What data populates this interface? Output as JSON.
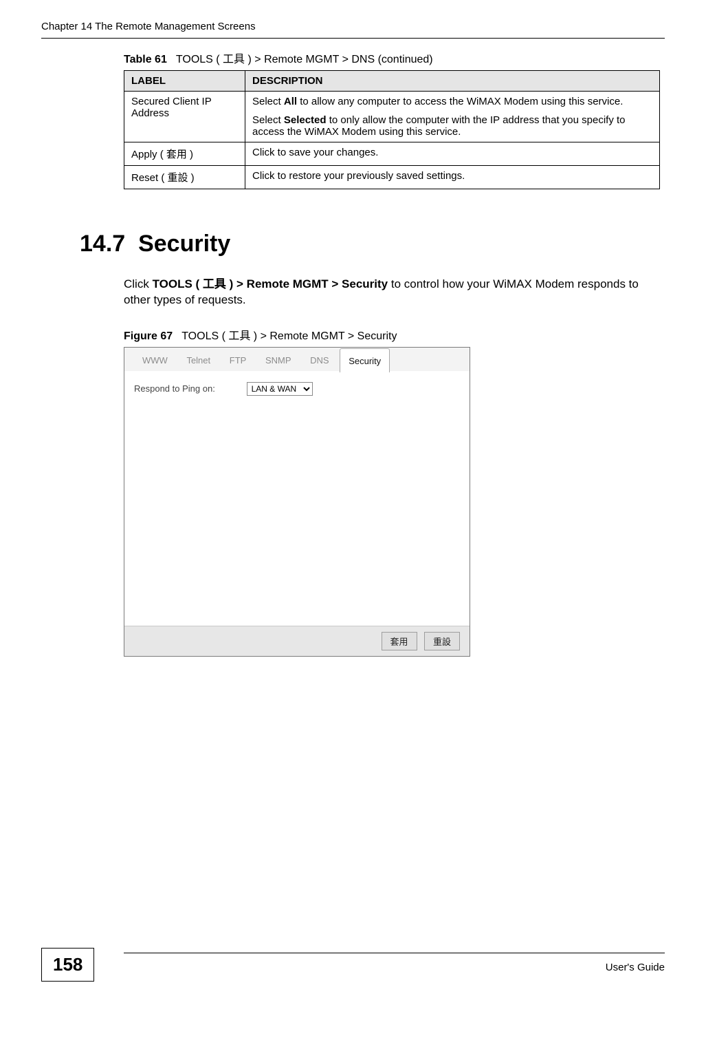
{
  "running_header": "Chapter 14 The Remote Management Screens",
  "table61": {
    "caption_prefix": "Table 61",
    "caption_text": "TOOLS ( 工具 ) > Remote MGMT > DNS (continued)",
    "headers": {
      "label": "LABEL",
      "description": "DESCRIPTION"
    },
    "rows": [
      {
        "label": "Secured Client IP Address",
        "desc1": "Select All to allow any computer to access the WiMAX Modem using this service.",
        "desc2": "Select Selected to only allow the computer with the IP address that you specify to access the WiMAX Modem using this service."
      },
      {
        "label": "Apply ( 套用 )",
        "desc1": "Click to save your changes."
      },
      {
        "label": "Reset ( 重設 )",
        "desc1": "Click to restore your previously saved settings."
      }
    ]
  },
  "section": {
    "number": "14.7",
    "title": "Security",
    "body": "Click TOOLS ( 工具 ) > Remote MGMT > Security to control how your WiMAX Modem responds to other types of requests."
  },
  "figure67": {
    "caption_prefix": "Figure 67",
    "caption_text": "TOOLS ( 工具 ) > Remote MGMT > Security",
    "tabs": [
      "WWW",
      "Telnet",
      "FTP",
      "SNMP",
      "DNS",
      "Security"
    ],
    "active_tab": "Security",
    "field_label": "Respond to Ping on:",
    "select_value": "LAN & WAN",
    "buttons": {
      "apply": "套用",
      "reset": "重設"
    }
  },
  "footer": {
    "page_number": "158",
    "guide": "User's Guide"
  }
}
